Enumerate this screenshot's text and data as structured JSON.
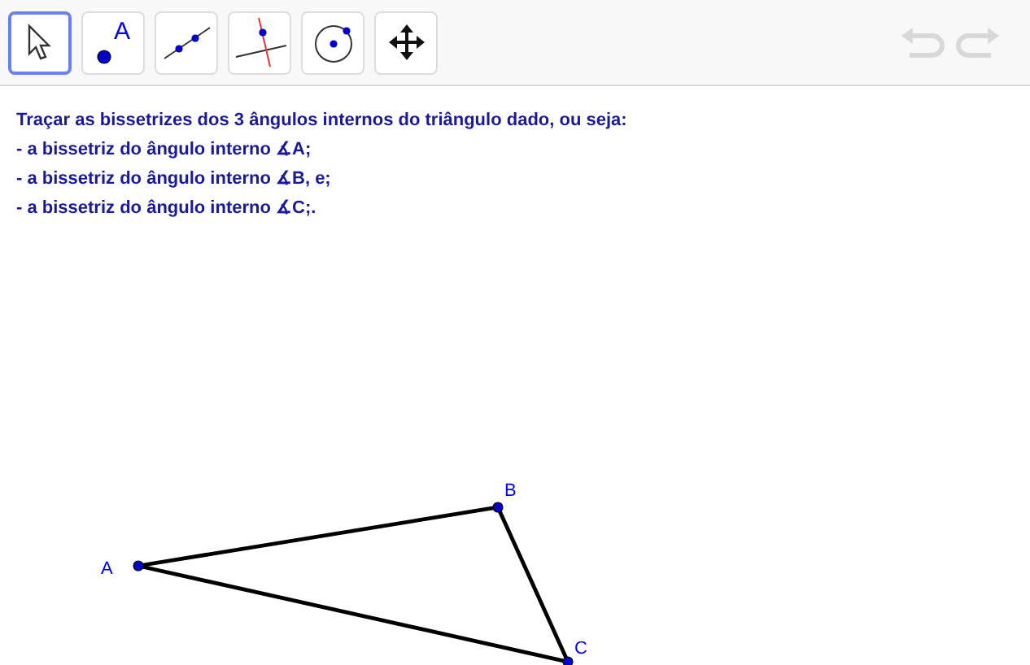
{
  "toolbar": {
    "tools": [
      {
        "kind": "move",
        "selected": true
      },
      {
        "kind": "point",
        "selected": false,
        "label": "A"
      },
      {
        "kind": "line",
        "selected": false
      },
      {
        "kind": "perpendicular",
        "selected": false
      },
      {
        "kind": "circle",
        "selected": false
      },
      {
        "kind": "move-view",
        "selected": false
      }
    ],
    "undo": {
      "disabled": true
    },
    "redo": {
      "disabled": true
    }
  },
  "instructions": [
    "Traçar as bissetrizes dos 3 ângulos internos do triângulo dado, ou seja:",
    "- a bissetriz do ângulo interno ∡A;",
    "- a bissetriz do ângulo interno ∡B, e;",
    "- a bissetriz do ângulo interno ∡C;."
  ],
  "points": [
    {
      "label": "A"
    },
    {
      "label": "B"
    },
    {
      "label": "C"
    }
  ]
}
